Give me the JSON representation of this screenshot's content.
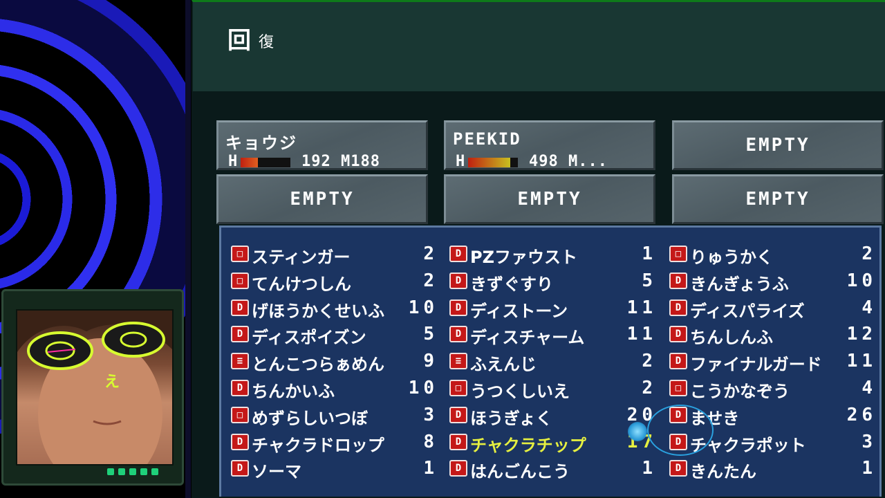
{
  "header": {
    "title": "回",
    "subtitle": "復"
  },
  "colors": {
    "header_bg": "#193733",
    "panel_bg": "#1b3461",
    "selected_text": "#e6f040",
    "tag_red": "#c41818"
  },
  "party": [
    {
      "name": "キョウジ",
      "hp_label": "H",
      "stats": "192 M188",
      "hp_fraction": 0.35,
      "hp_color": "#e06020"
    },
    {
      "name": "PEEKID",
      "hp_label": "H",
      "stats": "498 M...",
      "hp_fraction": 0.85,
      "hp_color": "#c8c020"
    },
    {
      "empty": "EMPTY"
    },
    {
      "empty": "EMPTY"
    },
    {
      "empty": "EMPTY"
    },
    {
      "empty": "EMPTY"
    }
  ],
  "items": [
    [
      {
        "tag": "□",
        "name": "スティンガー",
        "qty": "2"
      },
      {
        "tag": "□",
        "name": "てんけつしん",
        "qty": "2"
      },
      {
        "tag": "D",
        "name": "げほうかくせいふ",
        "qty": "10"
      },
      {
        "tag": "D",
        "name": "ディスポイズン",
        "qty": "5"
      },
      {
        "tag": "≡",
        "name": "とんこつらぁめん",
        "qty": "9"
      },
      {
        "tag": "D",
        "name": "ちんかいふ",
        "qty": "10"
      },
      {
        "tag": "□",
        "name": "めずらしいつぼ",
        "qty": "3"
      },
      {
        "tag": "D",
        "name": "チャクラドロップ",
        "qty": "8"
      },
      {
        "tag": "D",
        "name": "ソーマ",
        "qty": "1"
      }
    ],
    [
      {
        "tag": "D",
        "name": "PZファウスト",
        "qty": "1"
      },
      {
        "tag": "D",
        "name": "きずぐすり",
        "qty": "5"
      },
      {
        "tag": "D",
        "name": "ディストーン",
        "qty": "11"
      },
      {
        "tag": "D",
        "name": "ディスチャーム",
        "qty": "11"
      },
      {
        "tag": "≡",
        "name": "ふえんじ",
        "qty": "2"
      },
      {
        "tag": "□",
        "name": "うつくしいえ",
        "qty": "2"
      },
      {
        "tag": "D",
        "name": "ほうぎょく",
        "qty": "20"
      },
      {
        "tag": "D",
        "name": "チャクラチップ",
        "qty": "17",
        "selected": true
      },
      {
        "tag": "D",
        "name": "はんごんこう",
        "qty": "1"
      }
    ],
    [
      {
        "tag": "□",
        "name": "りゅうかく",
        "qty": "2"
      },
      {
        "tag": "D",
        "name": "きんぎょうふ",
        "qty": "10"
      },
      {
        "tag": "D",
        "name": "ディスパライズ",
        "qty": "4"
      },
      {
        "tag": "D",
        "name": "ちんしんふ",
        "qty": "12"
      },
      {
        "tag": "D",
        "name": "ファイナルガード",
        "qty": "11"
      },
      {
        "tag": "□",
        "name": "こうかなぞう",
        "qty": "4"
      },
      {
        "tag": "D",
        "name": "ませき",
        "qty": "26"
      },
      {
        "tag": "D",
        "name": "チャクラポット",
        "qty": "3"
      },
      {
        "tag": "D",
        "name": "きんたん",
        "qty": "1"
      }
    ]
  ]
}
